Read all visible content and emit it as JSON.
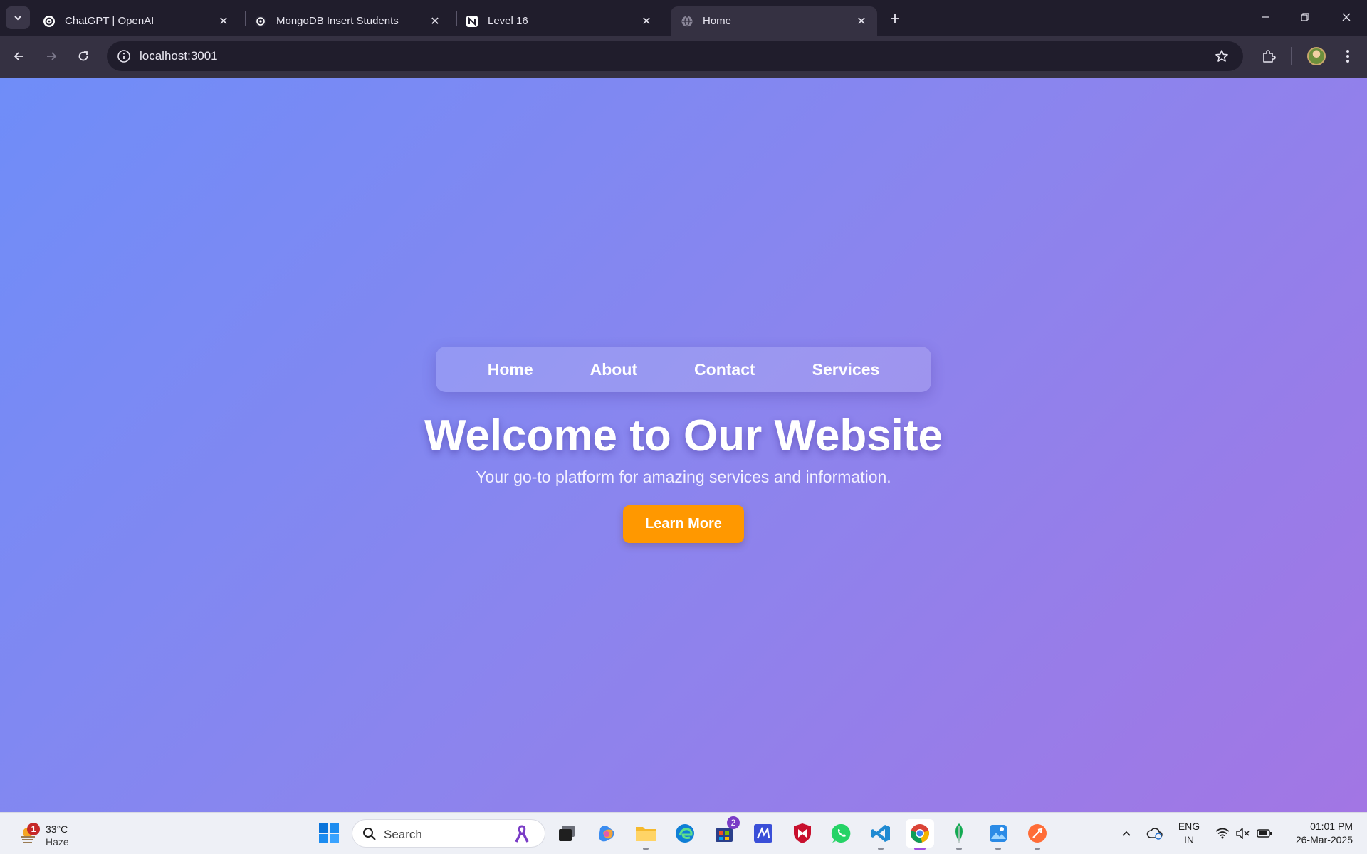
{
  "browser": {
    "tabs": [
      {
        "title": "ChatGPT | OpenAI",
        "favicon": "openai-icon",
        "active": false
      },
      {
        "title": "MongoDB Insert Students",
        "favicon": "openai-icon",
        "active": false
      },
      {
        "title": "Level 16",
        "favicon": "notion-icon",
        "active": false
      },
      {
        "title": "Home",
        "favicon": "globe-icon",
        "active": true
      }
    ],
    "close_glyph": "✕",
    "address": "localhost:3001"
  },
  "page": {
    "nav": [
      "Home",
      "About",
      "Contact",
      "Services"
    ],
    "title": "Welcome to Our Website",
    "subtitle": "Your go-to platform for amazing services and information.",
    "cta_label": "Learn More",
    "colors": {
      "gradient_start": "#6f8df8",
      "gradient_end": "#a276e4",
      "cta": "#ff9800"
    }
  },
  "taskbar": {
    "weather": {
      "badge": "1",
      "temp": "33°C",
      "condition": "Haze"
    },
    "search_placeholder": "Search",
    "store_badge": "2",
    "lang": {
      "line1": "ENG",
      "line2": "IN"
    },
    "clock": {
      "time": "01:01 PM",
      "date": "26-Mar-2025"
    }
  }
}
